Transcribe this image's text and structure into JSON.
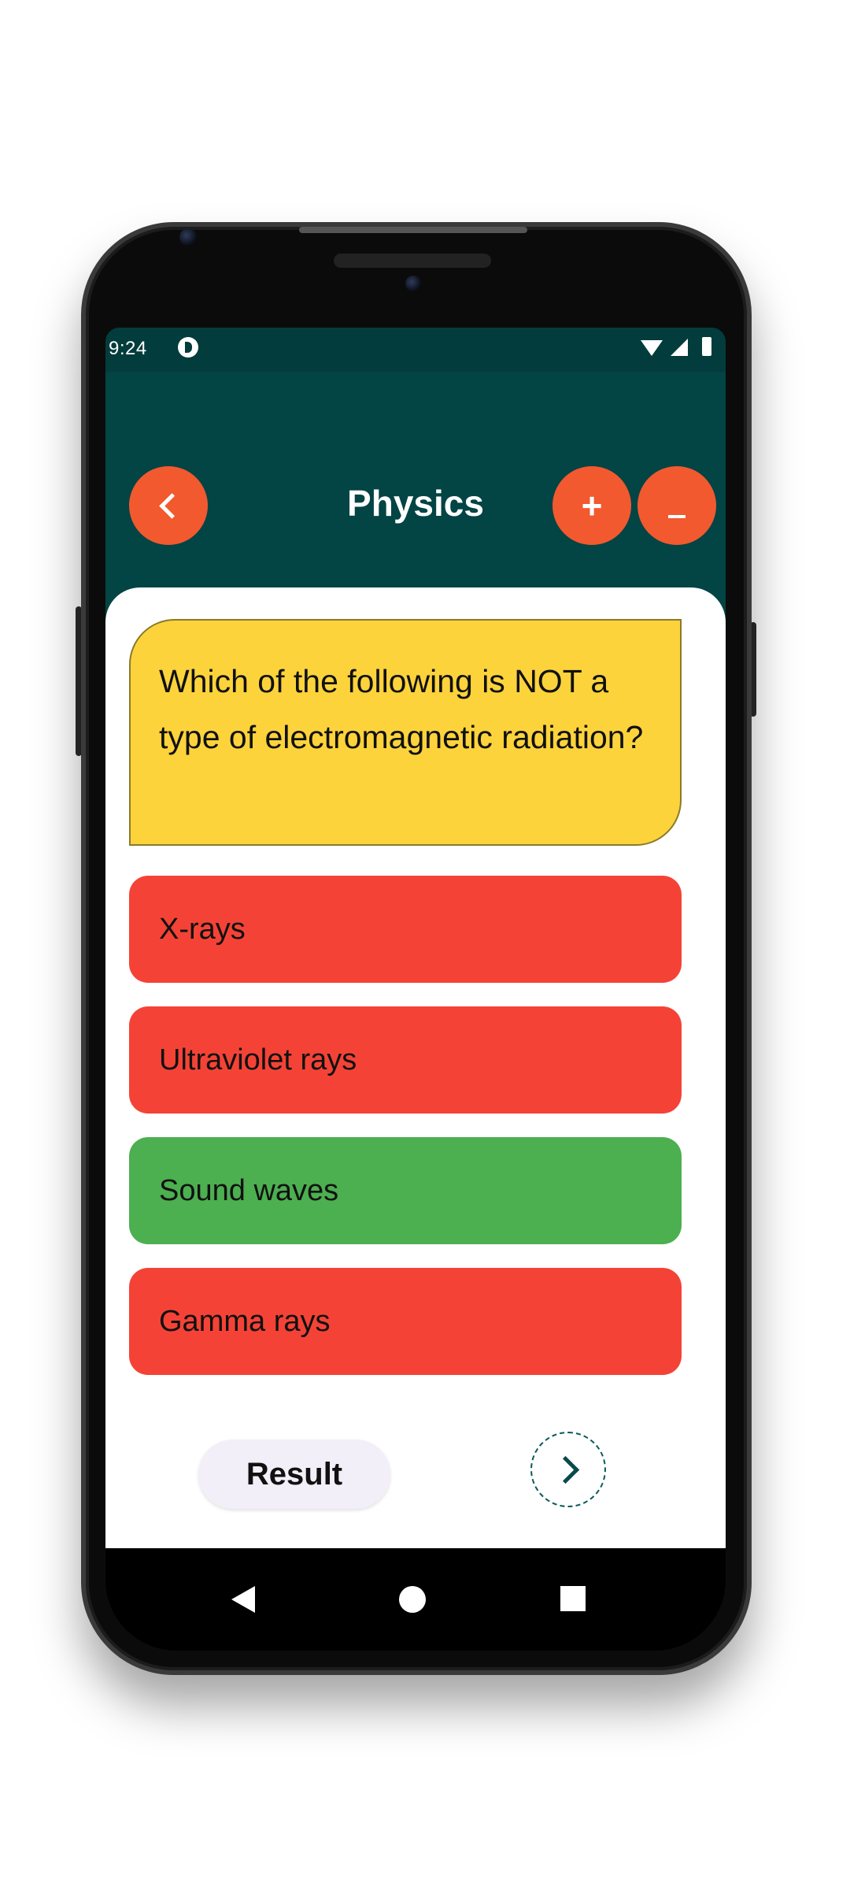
{
  "status_bar": {
    "time": "9:24",
    "app_icon": "notification-app-icon",
    "icons": [
      "wifi-icon",
      "signal-icon",
      "battery-icon"
    ]
  },
  "app_bar": {
    "title": "Physics",
    "back_icon": "chevron-left-icon",
    "plus_label": "+",
    "minus_label": "_",
    "button_color": "#f2592f",
    "background_color": "#034444"
  },
  "question": {
    "text": "Which of the following is NOT a type of electromagnetic radiation?",
    "background_color": "#fdd33c"
  },
  "options": [
    {
      "label": "X-rays",
      "state": "wrong",
      "color": "#f44336"
    },
    {
      "label": "Ultraviolet rays",
      "state": "wrong",
      "color": "#f44336"
    },
    {
      "label": "Sound waves",
      "state": "correct",
      "color": "#4caf50"
    },
    {
      "label": "Gamma rays",
      "state": "wrong",
      "color": "#f44336"
    }
  ],
  "footer": {
    "result_label": "Result",
    "next_icon": "chevron-right-icon"
  },
  "nav_bar": {
    "icons": [
      "nav-back-icon",
      "nav-home-icon",
      "nav-recents-icon"
    ]
  }
}
